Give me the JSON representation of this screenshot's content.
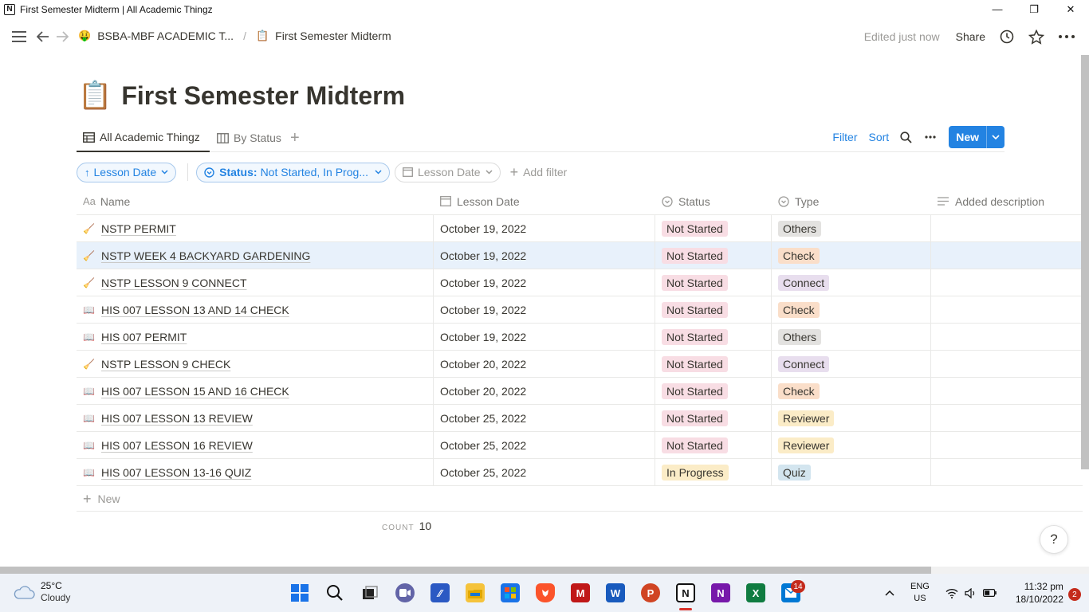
{
  "window": {
    "title": "First Semester Midterm | All Academic Thingz",
    "minimize": "—",
    "restore": "❐",
    "close": "✕"
  },
  "topbar": {
    "workspace_emoji": "🤑",
    "workspace_label": "BSBA-MBF ACADEMIC T...",
    "separator": "/",
    "page_emoji": "📋",
    "page_label": "First Semester Midterm",
    "edited": "Edited just now",
    "share": "Share"
  },
  "page": {
    "emoji": "📋",
    "title": "First Semester Midterm"
  },
  "views": {
    "tabs": [
      {
        "label": "All Academic Thingz",
        "active": true
      },
      {
        "label": "By Status",
        "active": false
      }
    ],
    "filter": "Filter",
    "sort": "Sort",
    "new": "New"
  },
  "filters": {
    "sort_pill": "Lesson Date",
    "status_key": "Status:",
    "status_value": "Not Started, In Prog...",
    "date_pill": "Lesson Date",
    "add_filter": "Add filter"
  },
  "table": {
    "headers": {
      "name": "Name",
      "date": "Lesson Date",
      "status": "Status",
      "type": "Type",
      "description": "Added description"
    },
    "rows": [
      {
        "icon": "🧹",
        "name": "NSTP PERMIT",
        "date": "October 19, 2022",
        "status": "Not Started",
        "type": "Others"
      },
      {
        "icon": "🧹",
        "name": "NSTP WEEK 4 BACKYARD GARDENING",
        "date": "October 19, 2022",
        "status": "Not Started",
        "type": "Check"
      },
      {
        "icon": "🧹",
        "name": "NSTP LESSON 9 CONNECT",
        "date": "October 19, 2022",
        "status": "Not Started",
        "type": "Connect"
      },
      {
        "icon": "📖",
        "name": "HIS 007 LESSON 13 AND 14 CHECK",
        "date": "October 19, 2022",
        "status": "Not Started",
        "type": "Check"
      },
      {
        "icon": "📖",
        "name": "HIS 007 PERMIT",
        "date": "October 19, 2022",
        "status": "Not Started",
        "type": "Others"
      },
      {
        "icon": "🧹",
        "name": "NSTP LESSON 9 CHECK",
        "date": "October 20, 2022",
        "status": "Not Started",
        "type": "Connect"
      },
      {
        "icon": "📖",
        "name": "HIS 007 LESSON 15 AND 16 CHECK",
        "date": "October 20, 2022",
        "status": "Not Started",
        "type": "Check"
      },
      {
        "icon": "📖",
        "name": "HIS 007 LESSON 13 REVIEW",
        "date": "October 25, 2022",
        "status": "Not Started",
        "type": "Reviewer"
      },
      {
        "icon": "📖",
        "name": "HIS 007 LESSON 16 REVIEW",
        "date": "October 25, 2022",
        "status": "Not Started",
        "type": "Reviewer"
      },
      {
        "icon": "📖",
        "name": "HIS 007 LESSON 13-16 QUIZ",
        "date": "October 25, 2022",
        "status": "In Progress",
        "type": "Quiz"
      }
    ],
    "new_row": "New",
    "count_label": "COUNT",
    "count_value": "10"
  },
  "tag_colors": {
    "Not Started": "#f8dde4",
    "In Progress": "#fbecc7",
    "Others": "#e3e2e0",
    "Check": "#fadec9",
    "Connect": "#e8deee",
    "Reviewer": "#fbecc7",
    "Quiz": "#d3e5ef"
  },
  "help": "?",
  "taskbar": {
    "temp": "25°C",
    "weather": "Cloudy",
    "lang": "ENG",
    "region": "US",
    "time": "11:32 pm",
    "date": "18/10/2022",
    "badge_mail": "14",
    "badge_notif": "2"
  }
}
